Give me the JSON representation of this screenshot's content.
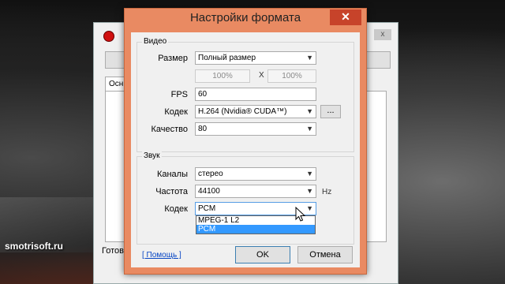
{
  "watermark": "smotrisoft.ru",
  "parent": {
    "tab_label": "Осн",
    "status": "Готов",
    "close_glyph": "х"
  },
  "dialog": {
    "title": "Настройки формата",
    "close_glyph": "✕",
    "video": {
      "legend": "Видео",
      "size_label": "Размер",
      "size_value": "Полный размер",
      "width_value": "100%",
      "x_sep": "X",
      "height_value": "100%",
      "fps_label": "FPS",
      "fps_value": "60",
      "codec_label": "Кодек",
      "codec_value": "H.264 (Nvidia® CUDA™)",
      "codec_more": "...",
      "quality_label": "Качество",
      "quality_value": "80"
    },
    "audio": {
      "legend": "Звук",
      "channels_label": "Каналы",
      "channels_value": "стерео",
      "rate_label": "Частота",
      "rate_value": "44100",
      "rate_unit": "Hz",
      "codec_label": "Кодек",
      "codec_value": "PCM",
      "codec_options": [
        "MPEG-1 L2",
        "PCM"
      ],
      "codec_highlighted": "PCM"
    },
    "help_link": "[ Помощь ]",
    "ok_label": "OK",
    "cancel_label": "Отмена"
  },
  "colors": {
    "title_bar": "#e98a62",
    "close_button": "#c7432a",
    "highlight": "#3399ff"
  }
}
